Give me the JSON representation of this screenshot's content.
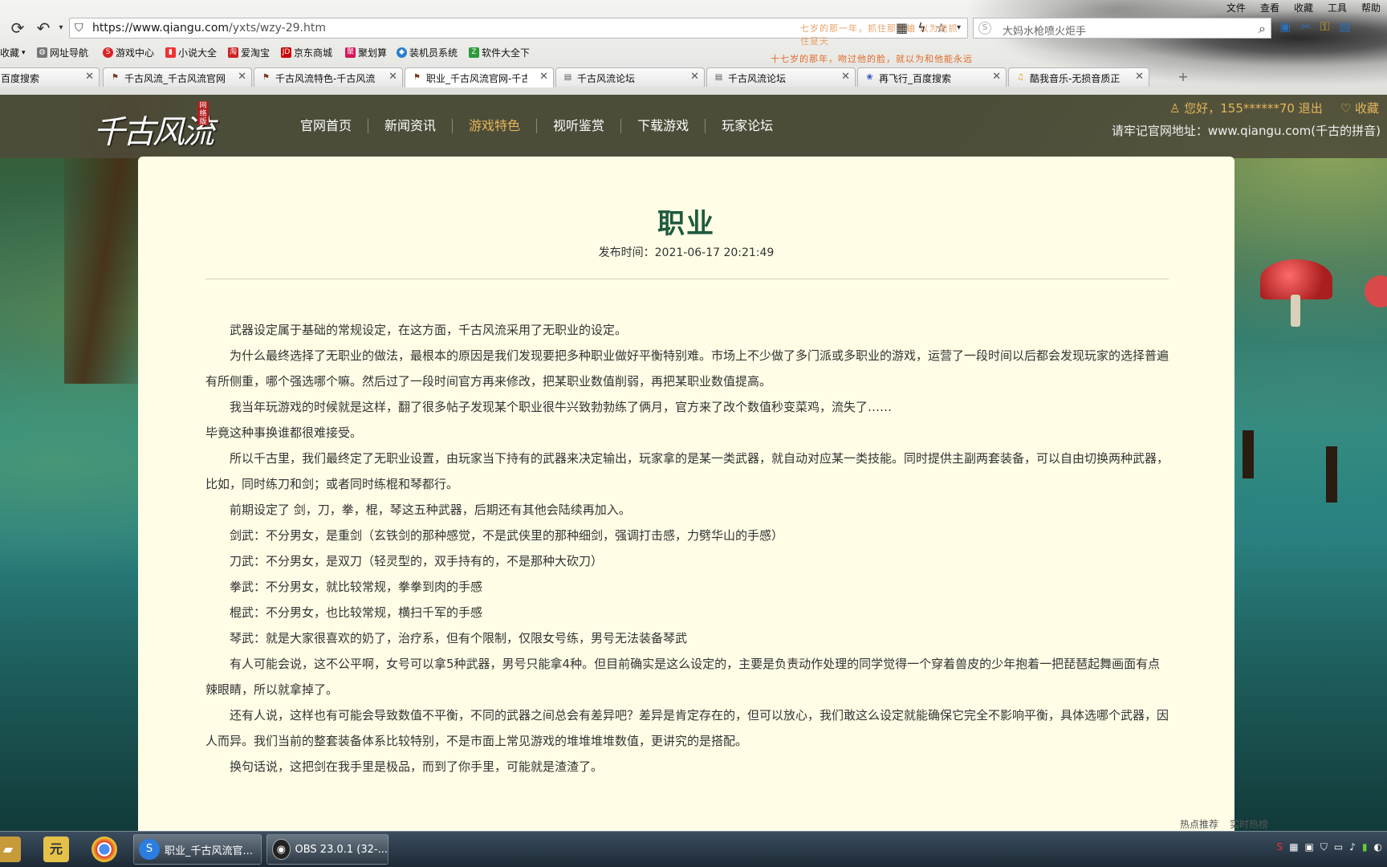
{
  "browser": {
    "menu": [
      "文件",
      "查看",
      "收藏",
      "工具",
      "帮助"
    ],
    "url_host": "https://www.qiangu.com",
    "url_path": "/yxts/wzy-29.htm",
    "marquee_top": "七岁的那一年，抓住那只蛐 以为能抓住夏天",
    "marquee_bottom": "十七岁的那年，吻过他的脸，就以为和他能永远",
    "search_text": "大妈水枪喷火炬手",
    "bookmarks": [
      "收藏",
      "网址导航",
      "游戏中心",
      "小说大全",
      "爱淘宝",
      "京东商城",
      "聚划算",
      "装机员系统",
      "软件大全下"
    ],
    "tabs": [
      {
        "label": "百度搜索",
        "icon": "paw-icon"
      },
      {
        "label": "千古风流_千古风流官网-",
        "icon": "game-icon"
      },
      {
        "label": "千古风流特色-千古风流",
        "icon": "game-icon"
      },
      {
        "label": "职业_千古风流官网-千古",
        "icon": "game-icon"
      },
      {
        "label": "千古风流论坛",
        "icon": "page-icon"
      },
      {
        "label": "千古风流论坛",
        "icon": "page-icon"
      },
      {
        "label": "再飞行_百度搜索",
        "icon": "paw-icon"
      },
      {
        "label": "酷我音乐-无损音质正",
        "icon": "music-icon"
      }
    ],
    "active_tab": 3
  },
  "site": {
    "logo_text": "千古风流",
    "logo_seal": "网络版",
    "nav": [
      "官网首页",
      "新闻资讯",
      "游戏特色",
      "视听鉴赏",
      "下载游戏",
      "玩家论坛"
    ],
    "nav_current": 2,
    "user_text": "您好，155******70 退出",
    "favorite_text": "收藏",
    "remember_text": "请牢记官网地址：www.qiangu.com(千古的拼音)"
  },
  "article": {
    "title": "职业",
    "date_label": "发布时间：",
    "date": "2021-06-17 20:21:49",
    "paragraphs": [
      {
        "text": "武器设定属于基础的常规设定，在这方面，千古风流采用了无职业的设定。",
        "indent": true
      },
      {
        "text": "为什么最终选择了无职业的做法，最根本的原因是我们发现要把多种职业做好平衡特别难。市场上不少做了多门派或多职业的游戏，运营了一段时间以后都会发现玩家的选择普遍有所侧重，哪个强选哪个嘛。然后过了一段时间官方再来修改，把某职业数值削弱，再把某职业数值提高。",
        "indent": true
      },
      {
        "text": "我当年玩游戏的时候就是这样，翻了很多帖子发现某个职业很牛兴致勃勃练了俩月，官方来了改个数值秒变菜鸡，流失了……",
        "indent": true
      },
      {
        "text": "毕竟这种事换谁都很难接受。",
        "indent": false
      },
      {
        "text": "所以千古里，我们最终定了无职业设置，由玩家当下持有的武器来决定输出，玩家拿的是某一类武器，就自动对应某一类技能。同时提供主副两套装备，可以自由切换两种武器，比如，同时练刀和剑；或者同时练棍和琴都行。",
        "indent": true
      },
      {
        "text": "前期设定了 剑，刀，拳，棍，琴这五种武器，后期还有其他会陆续再加入。",
        "indent": true
      },
      {
        "text": "剑武：不分男女，是重剑（玄铁剑的那种感觉，不是武侠里的那种细剑，强调打击感，力劈华山的手感）",
        "indent": true
      },
      {
        "text": "刀武：不分男女，是双刀（轻灵型的，双手持有的，不是那种大砍刀）",
        "indent": true
      },
      {
        "text": "拳武：不分男女，就比较常规，拳拳到肉的手感",
        "indent": true
      },
      {
        "text": "棍武：不分男女，也比较常规，横扫千军的手感",
        "indent": true
      },
      {
        "text": "琴武：就是大家很喜欢的奶了，治疗系，但有个限制，仅限女号练，男号无法装备琴武",
        "indent": true
      },
      {
        "text": "有人可能会说，这不公平啊，女号可以拿5种武器，男号只能拿4种。但目前确实是这么设定的，主要是负责动作处理的同学觉得一个穿着兽皮的少年抱着一把琵琶起舞画面有点辣眼睛，所以就拿掉了。",
        "indent": true
      },
      {
        "text": "还有人说，这样也有可能会导致数值不平衡，不同的武器之间总会有差异吧？差异是肯定存在的，但可以放心，我们敢这么设定就能确保它完全不影响平衡，具体选哪个武器，因人而异。我们当前的整套装备体系比较特别，不是市面上常见游戏的堆堆堆堆数值，更讲究的是搭配。",
        "indent": true
      },
      {
        "text": "换句话说，这把剑在我手里是极品，而到了你手里，可能就是渣渣了。",
        "indent": true
      }
    ]
  },
  "taskbar": {
    "buttons": [
      {
        "label": "职业_千古风流官...",
        "icon": "sogou-browser-icon"
      },
      {
        "label": "OBS 23.0.1 (32-...",
        "icon": "obs-icon"
      }
    ],
    "hot_items": [
      "热点推荐",
      "实时热榜"
    ]
  },
  "colors": {
    "accent_nav": "#e5b45a",
    "title_green": "#1f5a3c",
    "panel_bg": "#fffde6"
  }
}
